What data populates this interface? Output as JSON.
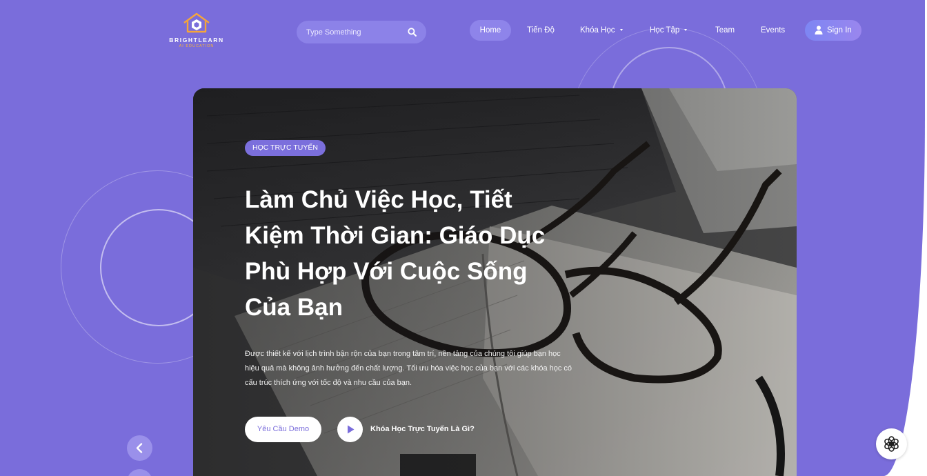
{
  "brand": {
    "name": "BRIGHTLEARN",
    "tagline": "AI EDUCATION",
    "logo_icon": "house-hexagon-logo-icon"
  },
  "search": {
    "placeholder": "Type Something",
    "icon": "search-icon"
  },
  "nav": {
    "items": [
      {
        "label": "Home",
        "active": true
      },
      {
        "label": "Tiến Độ"
      },
      {
        "label": "Khóa Học",
        "dropdown": true
      },
      {
        "label": "Học Tập",
        "dropdown": true
      },
      {
        "label": "Team"
      },
      {
        "label": "Events"
      }
    ],
    "signin_label": "Sign In",
    "signin_icon": "user-icon"
  },
  "hero": {
    "badge": "HỌC TRỰC TUYẾN",
    "title": "Làm Chủ Việc Học, Tiết Kiệm Thời Gian: Giáo Dục Phù Hợp Với Cuộc Sống Của Bạn",
    "description": "Được thiết kế với lịch trình bận rộn của bạn trong tâm trí, nền tảng của chúng tôi giúp bạn học hiệu quả mà không ảnh hưởng đến chất lượng. Tối ưu hóa việc học của bạn với các khóa học có cấu trúc thích ứng với tốc độ và nhu cầu của bạn.",
    "demo_button": "Yêu Cầu Demo",
    "video_label": "Khóa Học Trực Tuyến Là Gì?",
    "play_icon": "play-icon"
  },
  "slider": {
    "prev_icon": "chevron-left-icon",
    "next_icon": "chevron-right-icon"
  },
  "chat": {
    "icon": "chat-assistant-icon"
  },
  "colors": {
    "background": "#7a6ddb",
    "accent": "#7b6fdc",
    "logo_orange": "#f5a53a",
    "text_light": "#ffffff"
  }
}
